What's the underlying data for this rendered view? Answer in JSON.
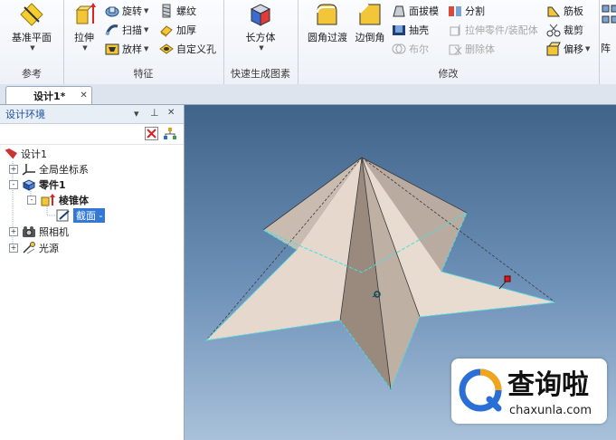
{
  "ribbon": {
    "groups": [
      {
        "label": "参考",
        "buttons": {
          "datum_plane": "基准平面"
        }
      },
      {
        "label": "特征",
        "buttons": {
          "extrude": "拉伸",
          "revolve": "旋转",
          "sweep": "扫描",
          "loft": "放样",
          "thread": "螺纹",
          "thicken": "加厚",
          "custom_hole": "自定义孔"
        }
      },
      {
        "label": "快速生成图素",
        "buttons": {
          "box": "长方体"
        }
      },
      {
        "label": "修改",
        "buttons": {
          "fillet": "圆角过渡",
          "chamfer": "边倒角",
          "draft": "面拔模",
          "shell": "抽壳",
          "boolean": "布尔",
          "split": "分割",
          "extrude_part": "拉伸零件/装配体",
          "delete_body": "删除体",
          "rib": "筋板",
          "trim": "裁剪",
          "offset": "偏移"
        }
      }
    ],
    "cut_off_label": "阵"
  },
  "document_tab": {
    "title": "设计1*",
    "close": "✕"
  },
  "panel": {
    "title": "设计环境",
    "controls": {
      "menu": "▾",
      "pin": "⊥",
      "close": "✕"
    },
    "tree": {
      "root": "设计1",
      "items": [
        {
          "label": "全局坐标系",
          "expander": "+"
        },
        {
          "label": "零件1",
          "expander": "-"
        },
        {
          "label": "棱锥体",
          "expander": "-"
        },
        {
          "label": "截面 -"
        },
        {
          "label": "照相机",
          "expander": "+"
        },
        {
          "label": "光源",
          "expander": "+"
        }
      ]
    }
  },
  "watermark": {
    "name": "查询啦",
    "url": "chaxunla.com"
  },
  "colors": {
    "accent": "#1a4f9a",
    "selection": "#3478d4",
    "watermark_blue": "#2a6fd6",
    "model_face": "#e6d8cc"
  }
}
